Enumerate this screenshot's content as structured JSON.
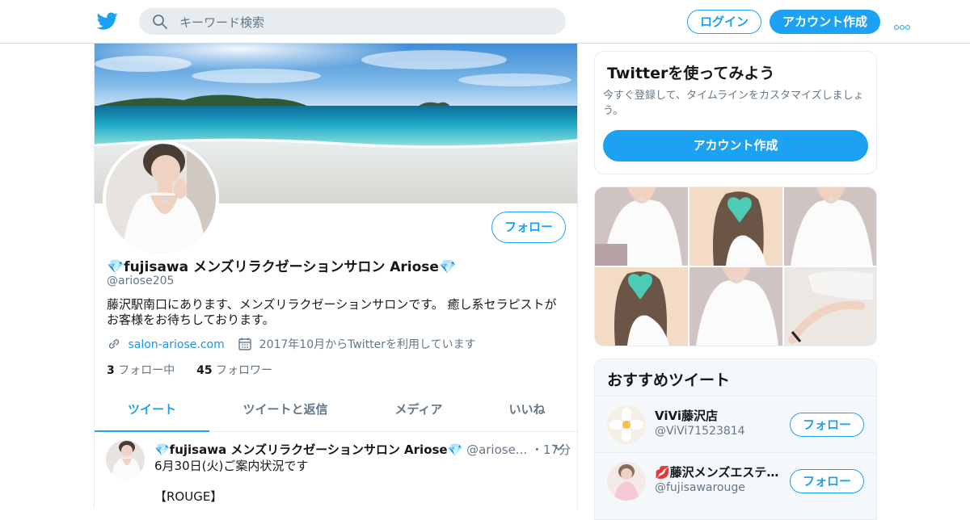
{
  "header": {
    "search_placeholder": "キーワード検索",
    "login_label": "ログイン",
    "signup_label": "アカウント作成",
    "more_icon": "more-icon"
  },
  "profile": {
    "name": "💎fujisawa メンズリラクゼーションサロン Ariose💎",
    "handle": "@ariose205",
    "bio": "藤沢駅南口にあります、メンズリラクゼーションサロンです。 癒し系セラピストがお客様をお待ちしております。",
    "website": "salon-ariose.com",
    "joined": "2017年10月からTwitterを利用しています",
    "following_count": "3",
    "following_label": "フォロー中",
    "followers_count": "45",
    "followers_label": "フォロワー",
    "follow_label": "フォロー"
  },
  "tabs": [
    "ツイート",
    "ツイートと返信",
    "メディア",
    "いいね"
  ],
  "tweet": {
    "name": "💎fujisawa メンズリラクゼーションサロン Ariose💎",
    "handle": "@ariose...",
    "separator": "・",
    "time": "17分",
    "text": "6月30日(火)ご案内状況です\n\n【ROUGE】"
  },
  "side_card": {
    "title": "Twitterを使ってみよう",
    "description": "今すぐ登録して、タイムラインをカスタマイズしましょう。",
    "button_label": "アカウント作成"
  },
  "recommended": {
    "title": "おすすめツイート",
    "users": [
      {
        "name": "ViVi藤沢店",
        "handle": "@ViVi71523814",
        "follow_label": "フォロー"
      },
      {
        "name": "💋藤沢メンズエステ…",
        "handle": "@fujisawarouge",
        "follow_label": "フォロー"
      }
    ]
  },
  "colors": {
    "accent": "#1da1f2",
    "text_primary": "#14171a",
    "text_secondary": "#657786",
    "border": "#e6ecf0"
  }
}
